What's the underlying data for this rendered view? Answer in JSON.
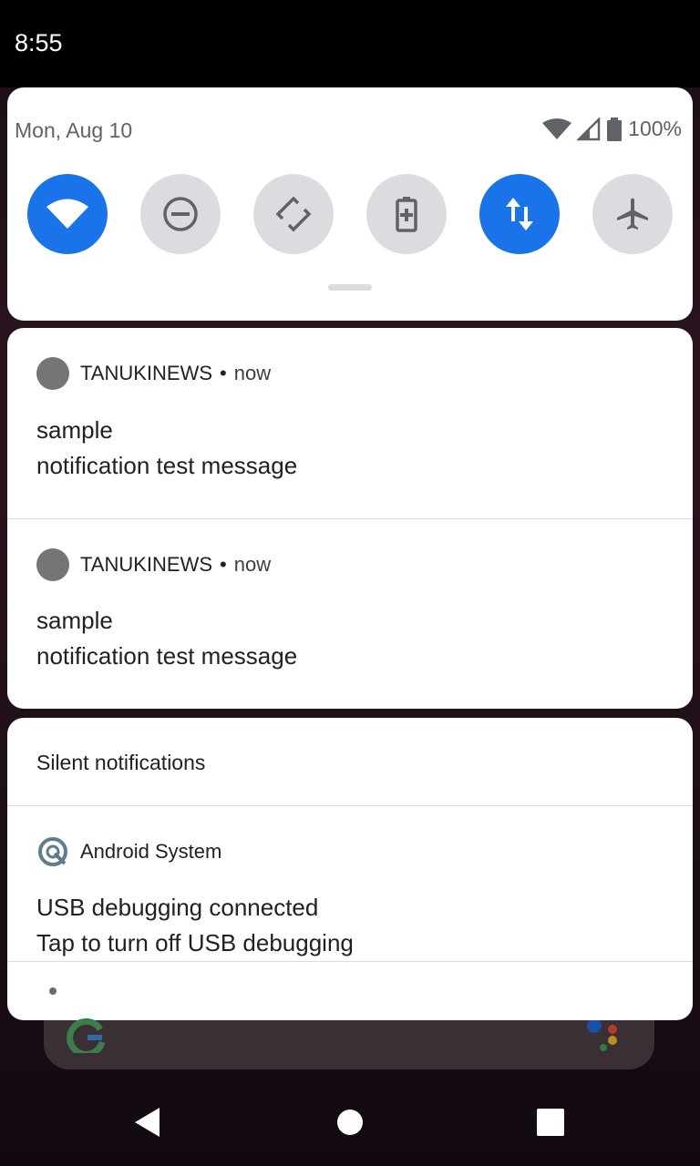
{
  "status_bar": {
    "time": "8:55"
  },
  "quick_settings": {
    "date": "Mon, Aug 10",
    "battery_percent": "100%",
    "tiles": [
      {
        "name": "wifi",
        "icon": "wifi-icon",
        "active": true
      },
      {
        "name": "do-not-disturb",
        "icon": "do-not-disturb-icon",
        "active": false
      },
      {
        "name": "auto-rotate",
        "icon": "auto-rotate-icon",
        "active": false
      },
      {
        "name": "battery-saver",
        "icon": "battery-saver-icon",
        "active": false
      },
      {
        "name": "mobile-data",
        "icon": "mobile-data-icon",
        "active": true
      },
      {
        "name": "airplane-mode",
        "icon": "airplane-icon",
        "active": false
      }
    ]
  },
  "notifications": [
    {
      "app": "TANUKINEWS",
      "separator": "•",
      "time": "now",
      "title": "sample",
      "text": "notification test message"
    },
    {
      "app": "TANUKINEWS",
      "separator": "•",
      "time": "now",
      "title": "sample",
      "text": "notification test message"
    }
  ],
  "silent": {
    "header": "Silent notifications",
    "item": {
      "app": "Android System",
      "title": "USB debugging connected",
      "text": "Tap to turn off USB debugging"
    }
  },
  "colors": {
    "accent": "#1a73e8",
    "tile_off": "#dadce0",
    "icon_gray": "#5f6368"
  }
}
